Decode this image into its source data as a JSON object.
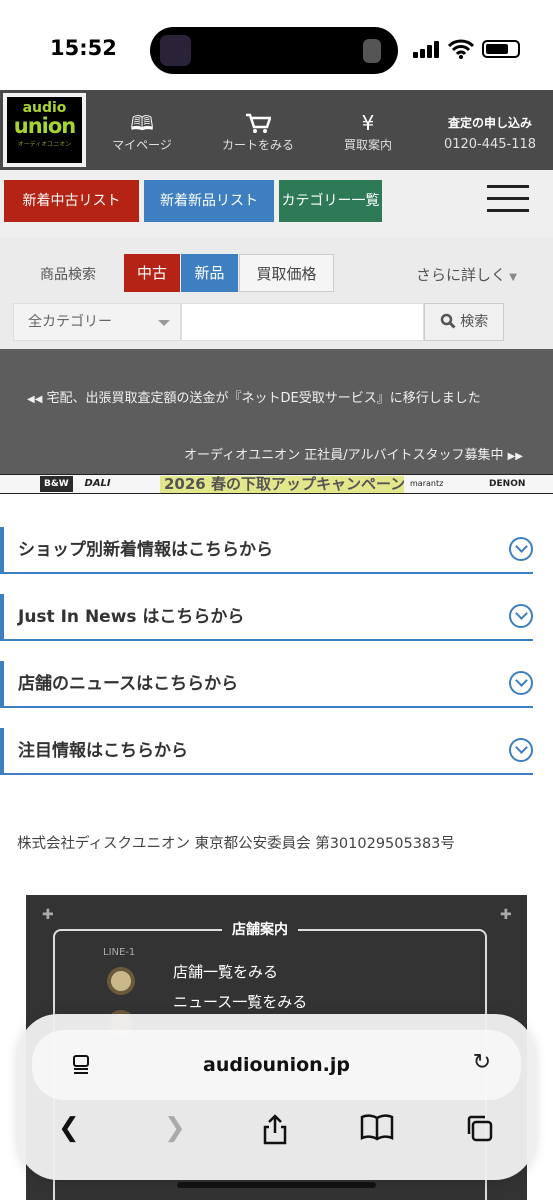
{
  "status": {
    "time": "15:52"
  },
  "header": {
    "logo_top": "audio",
    "logo_main": "union",
    "logo_sub": "オーディオユニオン",
    "nav": [
      {
        "label": "マイページ",
        "icon": "book-icon"
      },
      {
        "label": "カートをみる",
        "icon": "cart-icon"
      },
      {
        "label": "買取案内",
        "icon": "yen-icon"
      }
    ],
    "appraisal_title": "査定の申し込み",
    "appraisal_phone": "0120-445-118"
  },
  "categories": {
    "used_list": "新着中古リスト",
    "new_list": "新着新品リスト",
    "category_list": "カテゴリー一覧"
  },
  "search": {
    "label": "商品検索",
    "tab_used": "中古",
    "tab_new": "新品",
    "tab_buy": "買取価格",
    "more": "さらに詳しく",
    "category_value": "全カテゴリー",
    "button": "検索"
  },
  "ticker": {
    "item1": "宅配、出張買取査定額の送金が『ネットDE受取サービス』に移行しました",
    "item2": "オーディオユニオン 正社員/アルバイトスタッフ募集中"
  },
  "banner": {
    "brand1": "B&W",
    "brand2": "DALI",
    "campaign": "2026 春の下取アップキャンペーン",
    "brand3": "marantz",
    "brand4": "DENON"
  },
  "accordions": [
    "ショップ別新着情報はこちらから",
    "Just In News はこちらから",
    "店舗のニュースはこちらから",
    "注目情報はこちらから"
  ],
  "company": "株式会社ディスクユニオン 東京都公安委員会 第301029505383号",
  "store_panel": {
    "title": "店舗案内",
    "line_label": "LINE-1",
    "links": [
      "店舗一覧をみる",
      "ニュース一覧をみる"
    ]
  },
  "browser": {
    "url": "audiounion.jp"
  }
}
